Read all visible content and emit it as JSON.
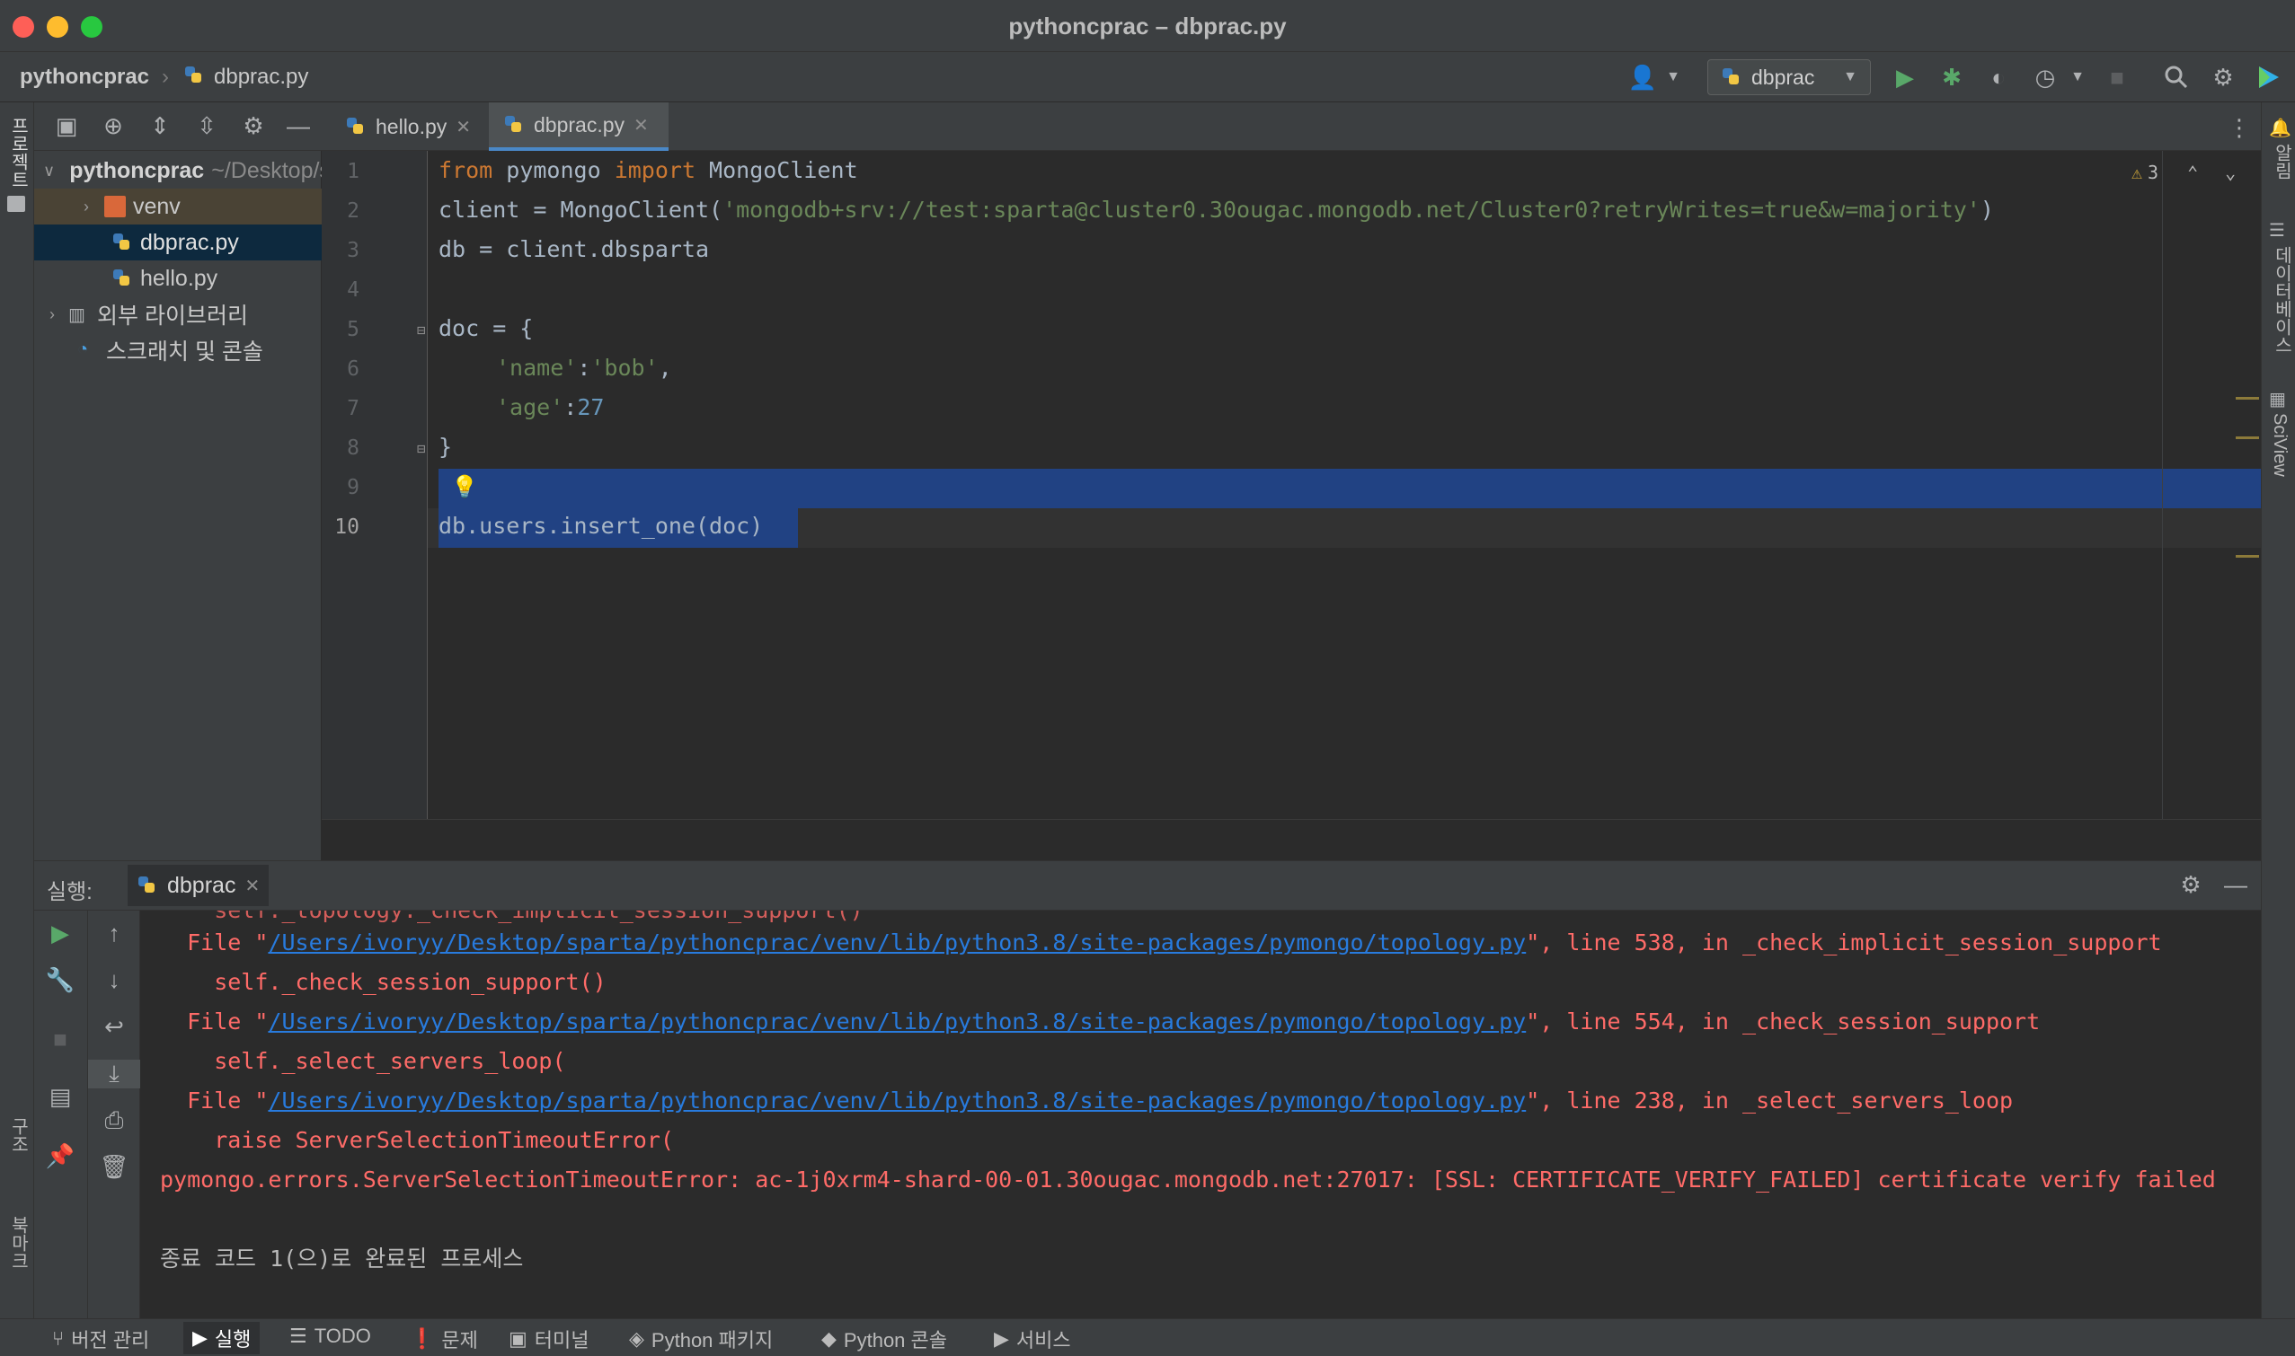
{
  "window": {
    "title": "pythoncprac – dbprac.py"
  },
  "breadcrumb": {
    "project": "pythoncprac",
    "file": "dbprac.py"
  },
  "toolbar": {
    "run_config": "dbprac"
  },
  "left_strip": {
    "project_label": "프로젝트",
    "structure_label": "구조",
    "bookmarks_label": "북마크"
  },
  "right_strip": {
    "notifications_label": "알림",
    "database_label": "데이터베이스",
    "sciview_label": "SciView"
  },
  "project_tree": {
    "root": "pythoncprac",
    "root_path": "~/Desktop/sparta/pythoncprac",
    "items": [
      {
        "label": "venv"
      },
      {
        "label": "dbprac.py"
      },
      {
        "label": "hello.py"
      },
      {
        "label": "외부 라이브러리"
      },
      {
        "label": "스크래치 및 콘솔"
      }
    ]
  },
  "tabs": [
    {
      "label": "hello.py"
    },
    {
      "label": "dbprac.py"
    }
  ],
  "editor": {
    "warnings_count": "3",
    "line_numbers": [
      "1",
      "2",
      "3",
      "4",
      "5",
      "6",
      "7",
      "8",
      "9",
      "10"
    ],
    "code": {
      "l1_kw1": "from",
      "l1_mod": " pymongo ",
      "l1_kw2": "import",
      "l1_name": " MongoClient",
      "l2_pre": "client = MongoClient(",
      "l2_str": "'mongodb+srv://test:sparta@cluster0.30ougac.mongodb.net/Cluster0?retryWrites=true&w=majority'",
      "l2_post": ")",
      "l3": "db = client.dbsparta",
      "l5": "doc = {",
      "l6_key": "'name'",
      "l6_sep": ":",
      "l6_val": "'bob'",
      "l6_post": ",",
      "l7_key": "'age'",
      "l7_sep": ":",
      "l7_val": "27",
      "l8": "}",
      "l10": "db.users.insert_one(doc)"
    }
  },
  "run_panel": {
    "label": "실행:",
    "tab": "dbprac",
    "lines": [
      {
        "prefix": "  File \"",
        "link": "/Users/ivoryy/Desktop/sparta/pythoncprac/venv/lib/python3.8/site-packages/pymongo/topology.py",
        "suffix": "\", line 538, in _check_implicit_session_support"
      },
      {
        "text": "    self._check_session_support()"
      },
      {
        "prefix": "  File \"",
        "link": "/Users/ivoryy/Desktop/sparta/pythoncprac/venv/lib/python3.8/site-packages/pymongo/topology.py",
        "suffix": "\", line 554, in _check_session_support"
      },
      {
        "text": "    self._select_servers_loop("
      },
      {
        "prefix": "  File \"",
        "link": "/Users/ivoryy/Desktop/sparta/pythoncprac/venv/lib/python3.8/site-packages/pymongo/topology.py",
        "suffix": "\", line 238, in _select_servers_loop"
      },
      {
        "text": "    raise ServerSelectionTimeoutError("
      },
      {
        "text": "pymongo.errors.ServerSelectionTimeoutError: ac-1j0xrm4-shard-00-01.30ougac.mongodb.net:27017: [SSL: CERTIFICATE_VERIFY_FAILED] certificate verify failed"
      }
    ],
    "exit_message": "종료 코드 1(으)로 완료된 프로세스"
  },
  "status_bar": {
    "items": [
      "버전 관리",
      "실행",
      "TODO",
      "문제",
      "터미널",
      "Python 패키지",
      "Python 콘솔",
      "서비스"
    ]
  },
  "colors": {
    "accent": "#4a88c7",
    "selection": "#214283",
    "error": "#ff6b68",
    "link": "#287bde",
    "run": "#59a869"
  }
}
